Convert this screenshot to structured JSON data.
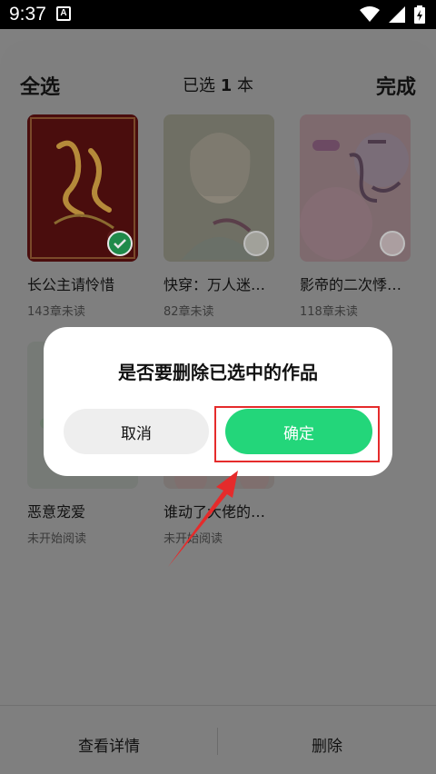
{
  "status_bar": {
    "time": "9:37",
    "notification_badge": "A"
  },
  "header": {
    "select_all": "全选",
    "selected_prefix": "已选 ",
    "selected_count": "1",
    "selected_suffix": " 本",
    "done": "完成"
  },
  "books": [
    {
      "title": "长公主请怜惜",
      "sub": "143章未读",
      "selected": true
    },
    {
      "title": "快穿：万人迷…",
      "sub": "82章未读",
      "selected": false
    },
    {
      "title": "影帝的二次悸…",
      "sub": "118章未读",
      "selected": false
    },
    {
      "title": "恶意宠爱",
      "sub": "未开始阅读",
      "selected": false
    },
    {
      "title": "谁动了大佬的…",
      "sub": "未开始阅读",
      "selected": false
    }
  ],
  "dialog": {
    "message": "是否要删除已选中的作品",
    "cancel": "取消",
    "confirm": "确定"
  },
  "bottom_bar": {
    "details": "查看详情",
    "delete": "删除"
  },
  "colors": {
    "confirm": "#23d67a",
    "highlight": "#e52b2b",
    "check": "#1f8a4a"
  }
}
